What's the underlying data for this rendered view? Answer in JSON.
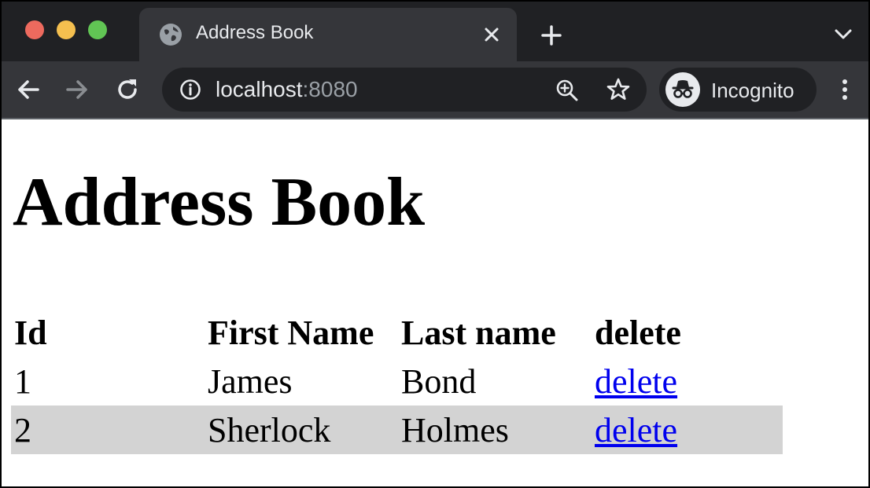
{
  "browser": {
    "tab_title": "Address Book",
    "url_host": "localhost",
    "url_port": ":8080",
    "profile_label": "Incognito"
  },
  "page": {
    "title": "Address Book",
    "table": {
      "headers": [
        "Id",
        "First Name",
        "Last name",
        "delete"
      ],
      "rows": [
        {
          "id": "1",
          "first": "James",
          "last": "Bond",
          "action": "delete"
        },
        {
          "id": "2",
          "first": "Sherlock",
          "last": "Holmes",
          "action": "delete"
        }
      ]
    }
  },
  "colors": {
    "traffic_close": "#ed6a5e",
    "traffic_min": "#f4bf4f",
    "traffic_max": "#61c554",
    "link": "#0000ee",
    "row_highlight": "#d3d3d3"
  },
  "icons": [
    "globe-icon",
    "close-icon",
    "plus-icon",
    "chevron-down-icon",
    "back-arrow-icon",
    "forward-arrow-icon",
    "reload-icon",
    "info-icon",
    "zoom-icon",
    "star-icon",
    "incognito-icon",
    "kebab-menu-icon"
  ]
}
